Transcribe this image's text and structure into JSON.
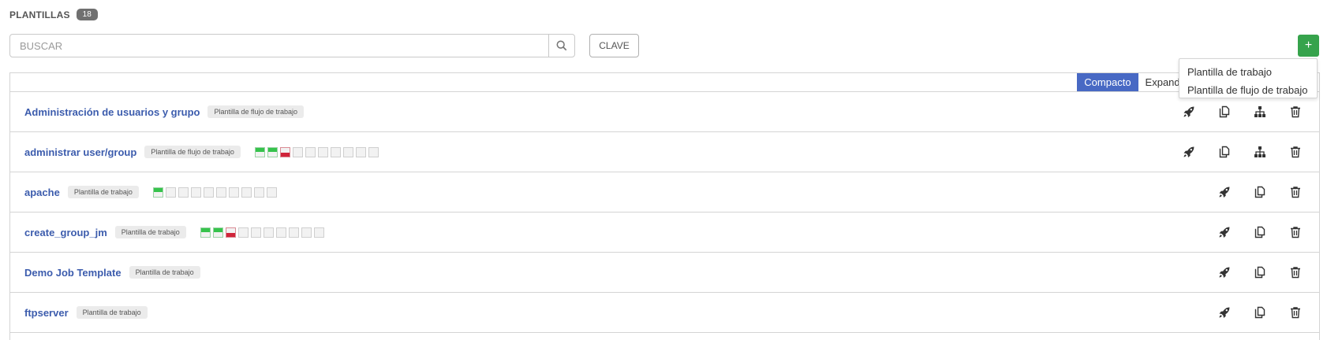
{
  "header": {
    "title": "PLANTILLAS",
    "count": "18"
  },
  "search": {
    "placeholder": "BUSCAR"
  },
  "toolbar": {
    "key_label": "CLAVE",
    "add_label": "+"
  },
  "add_menu": {
    "items": [
      "Plantilla de trabajo",
      "Plantilla de flujo de trabajo"
    ]
  },
  "view_toggle": {
    "compact": "Compacto",
    "expanded": "Expandido",
    "active": "compact"
  },
  "colors": {
    "accent": "#4869c4",
    "add": "#36a34c",
    "link": "#3c5cad",
    "success": "#36c34c",
    "failure": "#d0243a"
  },
  "templates": [
    {
      "name": "Administración de usuarios y grupo",
      "type": "Plantilla de flujo de trabajo",
      "workflow": true,
      "jobs": []
    },
    {
      "name": "administrar user/group",
      "type": "Plantilla de flujo de trabajo",
      "workflow": true,
      "jobs": [
        "ok",
        "ok",
        "fail",
        "none",
        "none",
        "none",
        "none",
        "none",
        "none",
        "none"
      ]
    },
    {
      "name": "apache",
      "type": "Plantilla de trabajo",
      "workflow": false,
      "jobs": [
        "ok",
        "none",
        "none",
        "none",
        "none",
        "none",
        "none",
        "none",
        "none",
        "none"
      ]
    },
    {
      "name": "create_group_jm",
      "type": "Plantilla de trabajo",
      "workflow": false,
      "jobs": [
        "ok",
        "ok",
        "fail",
        "none",
        "none",
        "none",
        "none",
        "none",
        "none",
        "none"
      ]
    },
    {
      "name": "Demo Job Template",
      "type": "Plantilla de trabajo",
      "workflow": false,
      "jobs": []
    },
    {
      "name": "ftpserver",
      "type": "Plantilla de trabajo",
      "workflow": false,
      "jobs": []
    }
  ],
  "action_icons": [
    "rocket-icon",
    "copy-icon",
    "workflow-visualizer-icon",
    "trash-icon"
  ]
}
